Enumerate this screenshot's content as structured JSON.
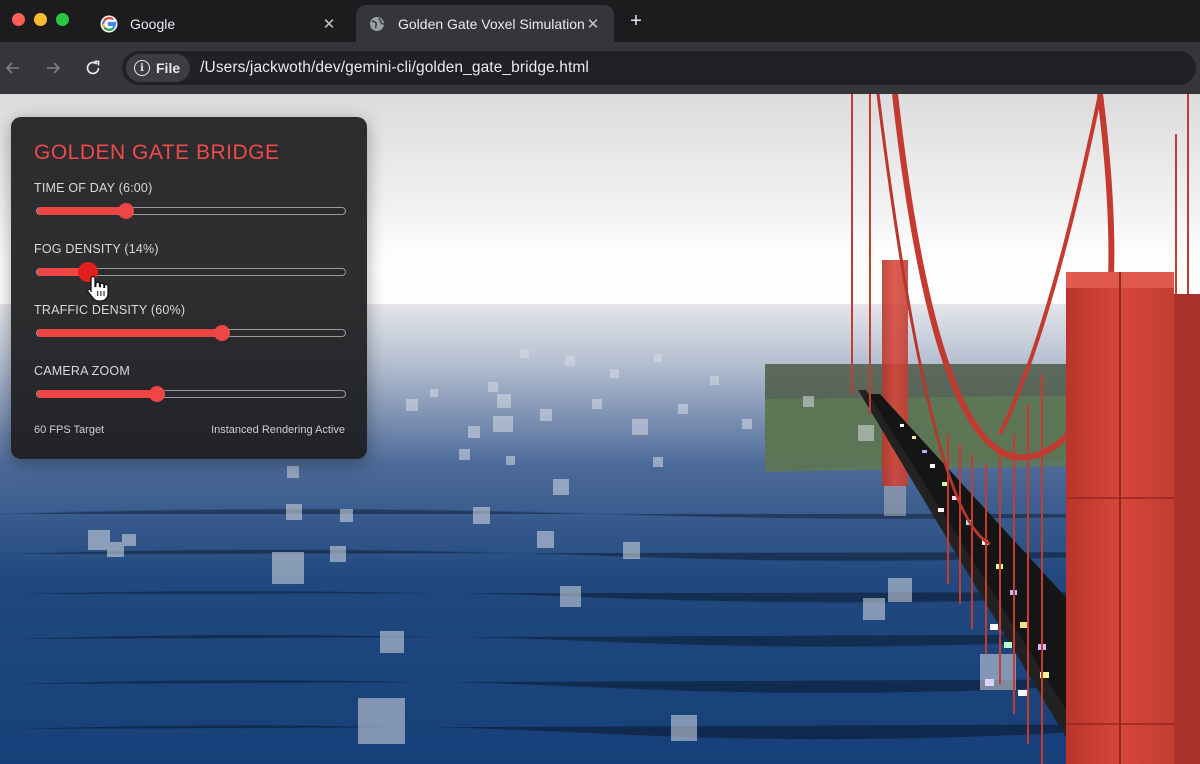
{
  "browser": {
    "tabs": [
      {
        "label": "Google",
        "favicon": "google-favicon-icon"
      },
      {
        "label": "Golden Gate Voxel Simulation",
        "favicon": "globe-icon"
      }
    ],
    "new_tab_icon": "plus-icon",
    "nav": {
      "back_icon": "arrow-left-icon",
      "forward_icon": "arrow-right-icon",
      "reload_icon": "reload-icon"
    },
    "address": {
      "scheme_chip": "File",
      "url": "/Users/jackwoth/dev/gemini-cli/golden_gate_bridge.html"
    }
  },
  "panel": {
    "title": "GOLDEN GATE BRIDGE",
    "sliders": [
      {
        "label": "TIME OF DAY (6:00)",
        "value": 0.29
      },
      {
        "label": "FOG DENSITY (14%)",
        "value": 0.165
      },
      {
        "label": "TRAFFIC DENSITY (60%)",
        "value": 0.6
      },
      {
        "label": "CAMERA ZOOM",
        "value": 0.39
      }
    ],
    "footer_left": "60 FPS Target",
    "footer_right": "Instanced Rendering Active"
  },
  "colors": {
    "accent": "#ef4444",
    "bridge_red": "#d5453a",
    "water": "#1f4b8a",
    "fog": "#ececec"
  }
}
